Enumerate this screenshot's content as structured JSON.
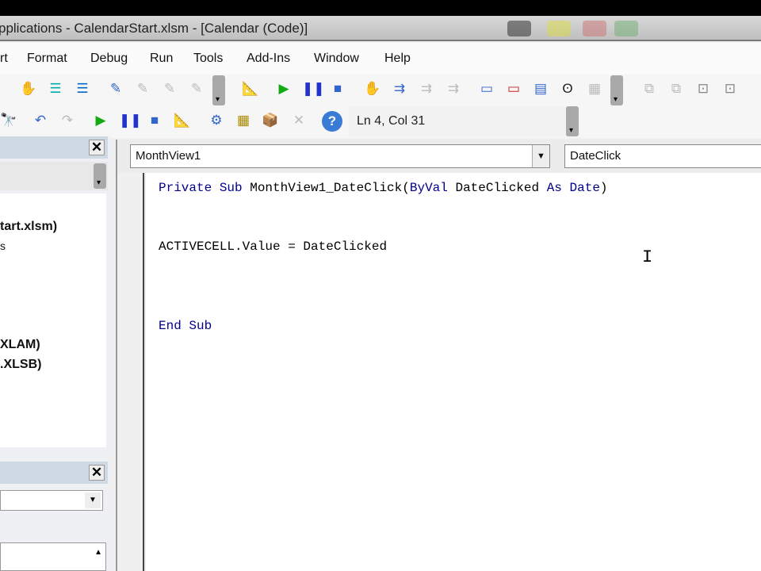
{
  "window": {
    "title": "pplications - CalendarStart.xlsm - [Calendar (Code)]"
  },
  "menu": [
    "rt",
    "Format",
    "Debug",
    "Run",
    "Tools",
    "Add-Ins",
    "Window",
    "Help"
  ],
  "status": {
    "position": "Ln 4, Col 31"
  },
  "project": {
    "items": [
      "tart.xlsm)",
      "s",
      "XLAM)",
      ".XLSB)"
    ]
  },
  "code": {
    "object_combo": "MonthView1",
    "procedure_combo": "DateClick",
    "line1": {
      "kw1": "Private Sub",
      "name": " MonthView1_DateClick(",
      "kw2": "ByVal",
      "mid": " DateClicked ",
      "kw3": "As",
      "kw4": " Date",
      ")": ")"
    },
    "line2": "ACTIVECELL.Value = DateClicked",
    "line3": "End Sub"
  }
}
